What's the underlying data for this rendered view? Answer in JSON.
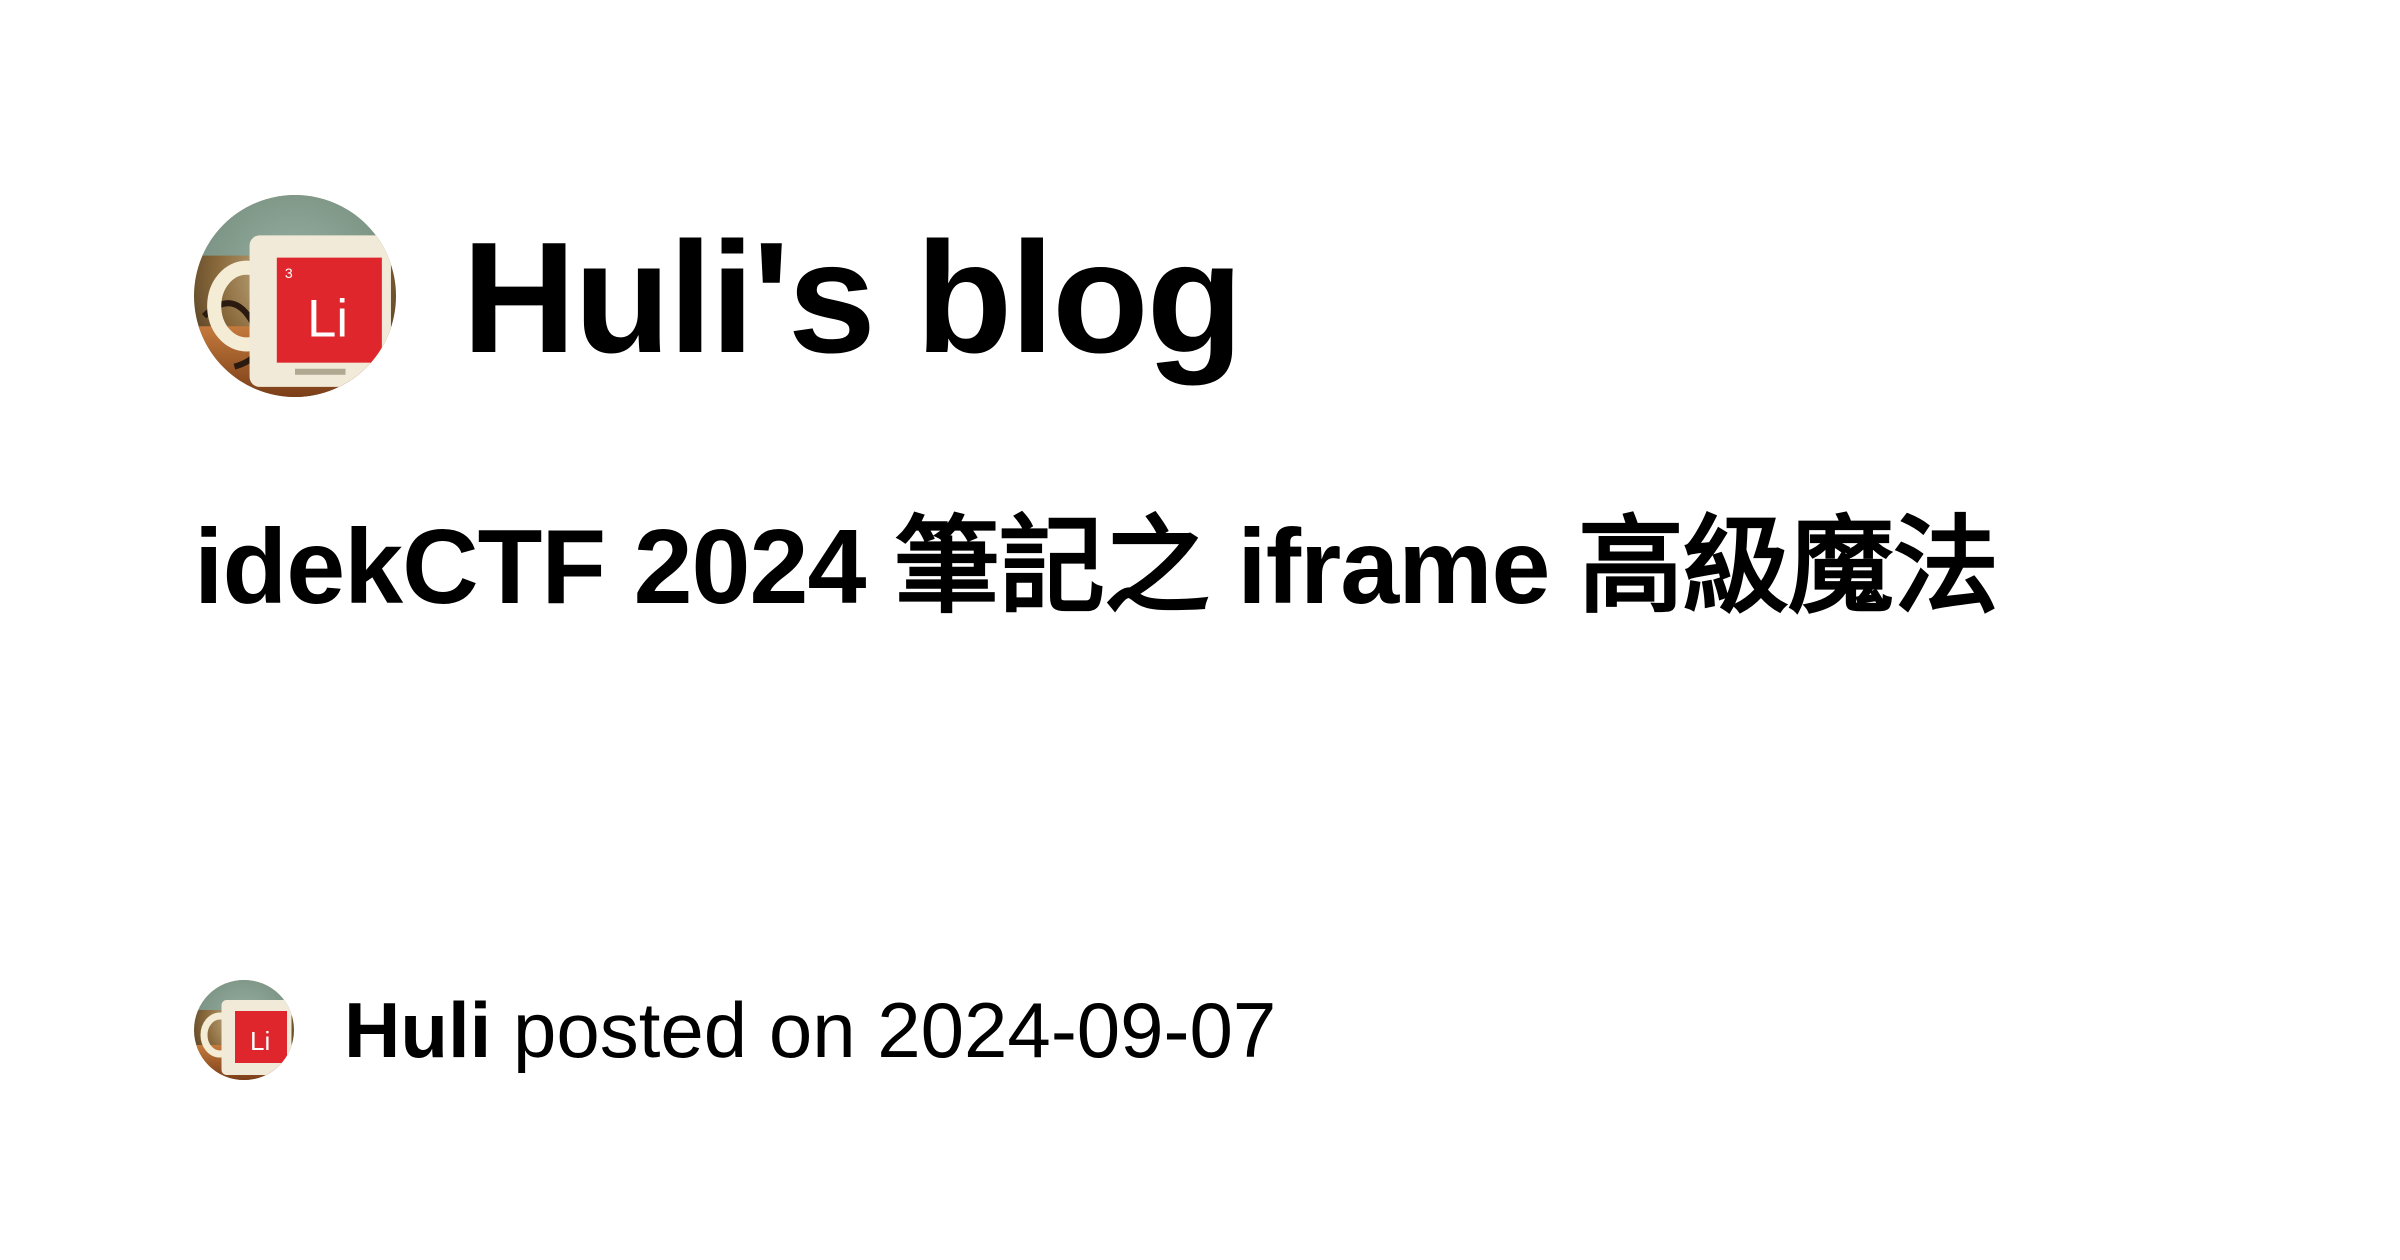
{
  "blog": {
    "title": "Huli's blog",
    "avatar_icon": "mug-avatar-icon",
    "avatar_mug_text": "Li",
    "avatar_mug_number": "3"
  },
  "post": {
    "title": "idekCTF 2024 筆記之 iframe 高級魔法"
  },
  "meta": {
    "author": "Huli",
    "posted_on_text": "posted on",
    "date": "2024-09-07"
  },
  "colors": {
    "background": "#ffffff",
    "text": "#000000",
    "mug_red": "#e0262d",
    "mug_body": "#f2ead8"
  }
}
